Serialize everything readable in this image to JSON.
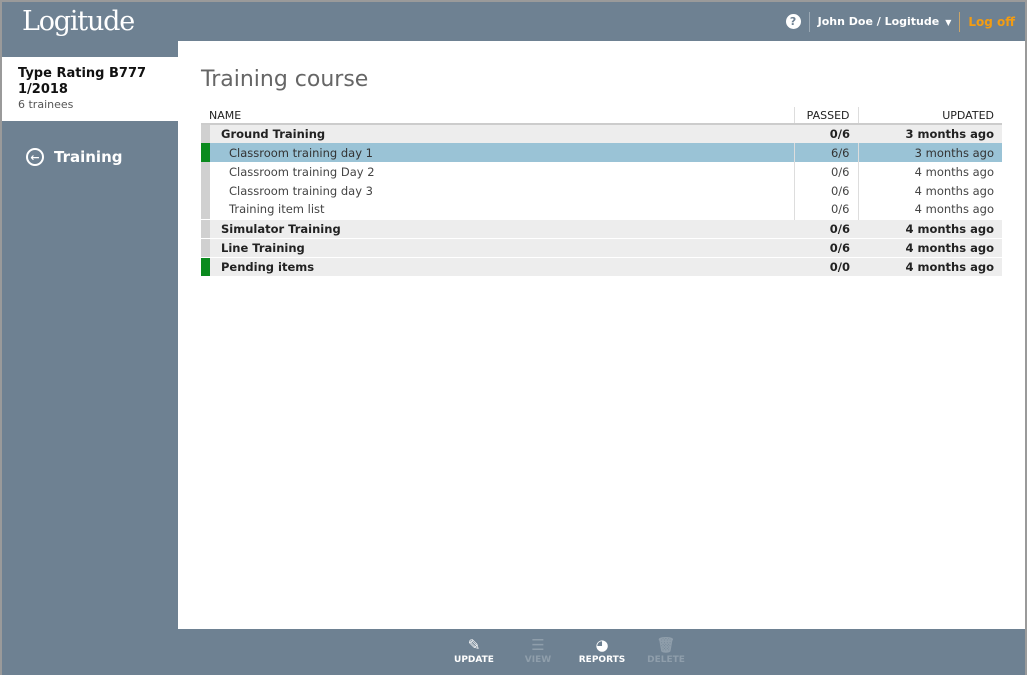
{
  "header": {
    "logo": "Logitude",
    "help_glyph": "?",
    "user": "John Doe / Logitude",
    "logoff": "Log off"
  },
  "sidebar": {
    "course_title_line1": "Type Rating B777",
    "course_title_line2": "1/2018",
    "course_sub": "6 trainees",
    "nav_label": "Training"
  },
  "main": {
    "title": "Training course",
    "columns": {
      "name": "NAME",
      "passed": "PASSED",
      "updated": "UPDATED"
    },
    "rows": [
      {
        "name": "Ground Training",
        "passed": "0/6",
        "updated": "3 months ago"
      },
      {
        "name": "Classroom training day 1",
        "passed": "6/6",
        "updated": "3 months ago"
      },
      {
        "name": "Classroom training Day 2",
        "passed": "0/6",
        "updated": "4 months ago"
      },
      {
        "name": "Classroom training day 3",
        "passed": "0/6",
        "updated": "4 months ago"
      },
      {
        "name": "Training item list",
        "passed": "0/6",
        "updated": "4 months ago"
      },
      {
        "name": "Simulator Training",
        "passed": "0/6",
        "updated": "4 months ago"
      },
      {
        "name": "Line Training",
        "passed": "0/6",
        "updated": "4 months ago"
      },
      {
        "name": "Pending items",
        "passed": "0/0",
        "updated": "4 months ago"
      }
    ]
  },
  "toolbar": {
    "update": "UPDATE",
    "view": "VIEW",
    "reports": "REPORTS",
    "delete": "DELETE"
  },
  "colors": {
    "bar": "#6e8192",
    "accent": "#f39c12",
    "selected": "#9ac3d6",
    "status_green": "#0a8a1e"
  }
}
